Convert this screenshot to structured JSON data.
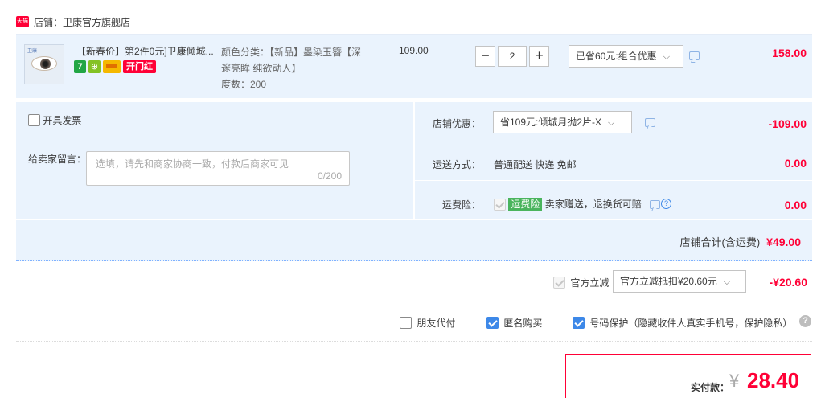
{
  "store": {
    "logo_text": "天猫",
    "name": "店铺：卫康官方旗舰店"
  },
  "item": {
    "thumb_text": "卫康",
    "title": "【新春价】第2件0元]卫康倾城...",
    "badges": {
      "seven": "7",
      "wx": "⊕",
      "kaimen": "开门红"
    },
    "sku_lines": [
      "颜色分类：【新品】墨染玉簪【深",
      "邃亮眸 纯欲动人】",
      "度数：200"
    ],
    "unit_price": "109.00",
    "qty_minus": "−",
    "qty_value": "2",
    "qty_plus": "+",
    "promo_select": "已省60元:组合优惠",
    "amount": "158.00"
  },
  "panel": {
    "invoice_label": "开具发票",
    "message_label": "给卖家留言：",
    "message_placeholder": "选填，请先和商家协商一致，付款后商家可见",
    "message_count": "0/200",
    "store_discount_label": "店铺优惠：",
    "store_discount_select": "省109元:倾城月抛2片-X",
    "store_discount_amount": "-109.00",
    "shipping_label": "运送方式：",
    "shipping_value": "普通配送 快递 免邮",
    "shipping_amount": "0.00",
    "insurance_label": "运费险：",
    "insurance_tag": "运费险",
    "insurance_text": "卖家赠送，退换货可赔",
    "insurance_amount": "0.00",
    "subtotal_label": "店铺合计(含运费)",
    "subtotal_amount": "¥49.00"
  },
  "official": {
    "label": "官方立减",
    "select": "官方立减抵扣¥20.60元",
    "amount": "-¥20.60"
  },
  "options": {
    "friend_pay": "朋友代付",
    "anonymous": "匿名购买",
    "number_protect": "号码保护（隐藏收件人真实手机号，保护隐私）",
    "help": "?"
  },
  "pay": {
    "label": "实付款：",
    "yen": "¥",
    "amount": "28.40"
  },
  "colors": {
    "accent_red": "#ff0036",
    "panel_blue": "#eaf3fd",
    "check_blue": "#3d88e8",
    "green": "#4ab45d"
  }
}
